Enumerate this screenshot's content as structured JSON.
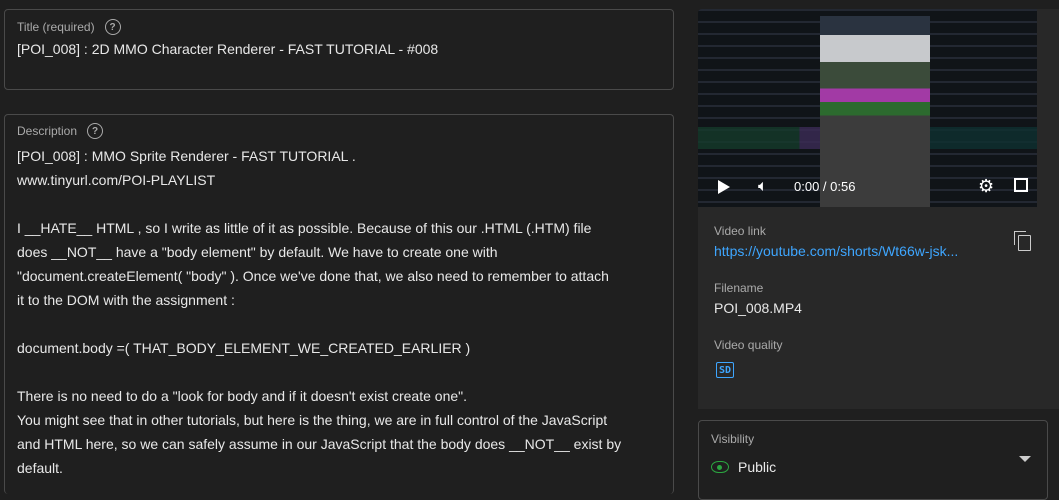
{
  "title_field": {
    "label": "Title (required)",
    "value": "[POI_008] : 2D MMO Character Renderer - FAST TUTORIAL - #008"
  },
  "description_field": {
    "label": "Description",
    "lines": [
      "[POI_008] : MMO Sprite Renderer - FAST TUTORIAL .",
      "www.tinyurl.com/POI-PLAYLIST",
      "",
      "I __HATE__ HTML , so I write as little of it as possible. Because of this our .HTML (.HTM) file",
      "does __NOT__ have a \"body element\" by default. We have to create one with",
      "\"document.createElement( \"body\" ). Once we've done that, we also need to remember to attach",
      "it to the DOM with the assignment :",
      "",
      "document.body =( THAT_BODY_ELEMENT_WE_CREATED_EARLIER )",
      "",
      "There is no need to do a \"look for body and if it doesn't exist create one\".",
      "You might see that in other tutorials, but here is the thing, we are in full control of the JavaScript",
      "and HTML here, so we can safely assume in our JavaScript that the body does __NOT__ exist by",
      "default."
    ]
  },
  "video": {
    "time": "0:00 / 0:56",
    "icons": [
      "play-icon",
      "volume-icon",
      "gear-icon",
      "fullscreen-icon"
    ]
  },
  "video_link": {
    "label": "Video link",
    "value": "https://youtube.com/shorts/Wt66w-jsk..."
  },
  "filename": {
    "label": "Filename",
    "value": "POI_008.MP4"
  },
  "video_quality": {
    "label": "Video quality",
    "badge": "SD"
  },
  "visibility": {
    "label": "Visibility",
    "value": "Public"
  },
  "colors": {
    "link": "#3ea6ff",
    "public_green": "#2ba640"
  }
}
